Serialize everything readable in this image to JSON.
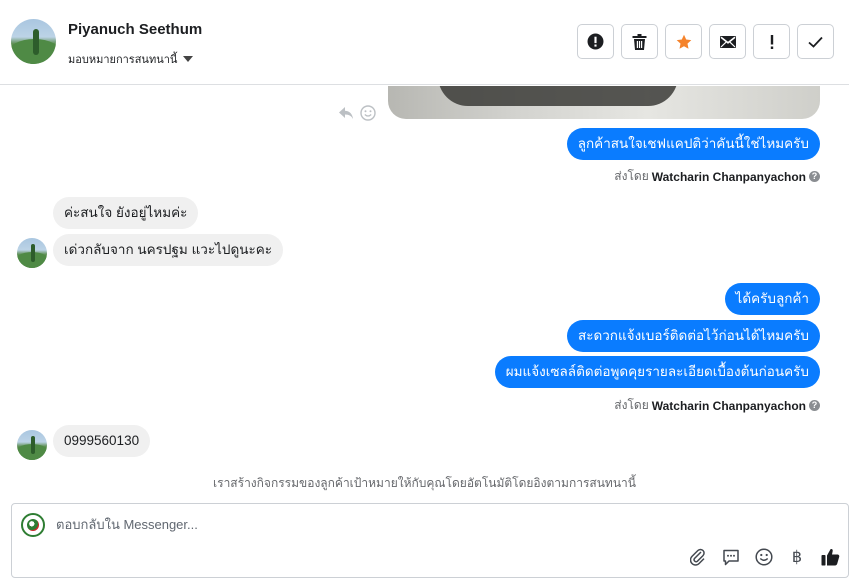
{
  "header": {
    "contact_name": "Piyanuch Seethum",
    "assign_label": "มอบหมายการสนทนานี้",
    "actions": [
      {
        "name": "spam-button",
        "icon": "alert-circle-icon"
      },
      {
        "name": "delete-button",
        "icon": "trash-icon"
      },
      {
        "name": "star-button",
        "icon": "star-icon",
        "color": "#f5832b"
      },
      {
        "name": "mark-unread-button",
        "icon": "envelope-icon"
      },
      {
        "name": "follow-up-button",
        "icon": "exclamation-icon"
      },
      {
        "name": "done-button",
        "icon": "check-icon"
      }
    ]
  },
  "messages": {
    "m1": "ลูกค้าสนใจเชฟแคปติว่าคันนี้ใช่ไหมครับ",
    "sent_by_1": {
      "prefix": "ส่งโดย",
      "name": "Watcharin Chanpanyachon"
    },
    "m2": "ค่ะสนใจ ยังอยู่ไหมค่ะ",
    "m3": "เด่วกลับจาก นครปฐม แวะไปดูนะคะ",
    "m4": "ได้ครับลูกค้า",
    "m5": "สะดวกแจ้งเบอร์ติดต่อไว้ก่อนได้ไหมครับ",
    "m6": "ผมแจ้งเซลล์ติดต่อพูดคุยรายละเอียดเบื้องต้นก่อนครับ",
    "sent_by_2": {
      "prefix": "ส่งโดย",
      "name": "Watcharin Chanpanyachon"
    },
    "m7": "0999560130",
    "help_glyph": "?"
  },
  "auto_note": "เราสร้างกิจกรรมของลูกค้าเป้าหมายให้กับคุณโดยอัตโนมัติโดยอิงตามการสนทนานี้",
  "composer": {
    "placeholder": "ตอบกลับใน Messenger...",
    "tools": [
      "paperclip-icon",
      "saved-replies-icon",
      "emoji-icon",
      "baht-icon",
      "thumbs-up-icon"
    ],
    "baht_glyph": "฿"
  },
  "colors": {
    "outgoing_bubble": "#0a7cff",
    "incoming_bubble": "#f0f0f0",
    "star_active": "#f5832b"
  }
}
